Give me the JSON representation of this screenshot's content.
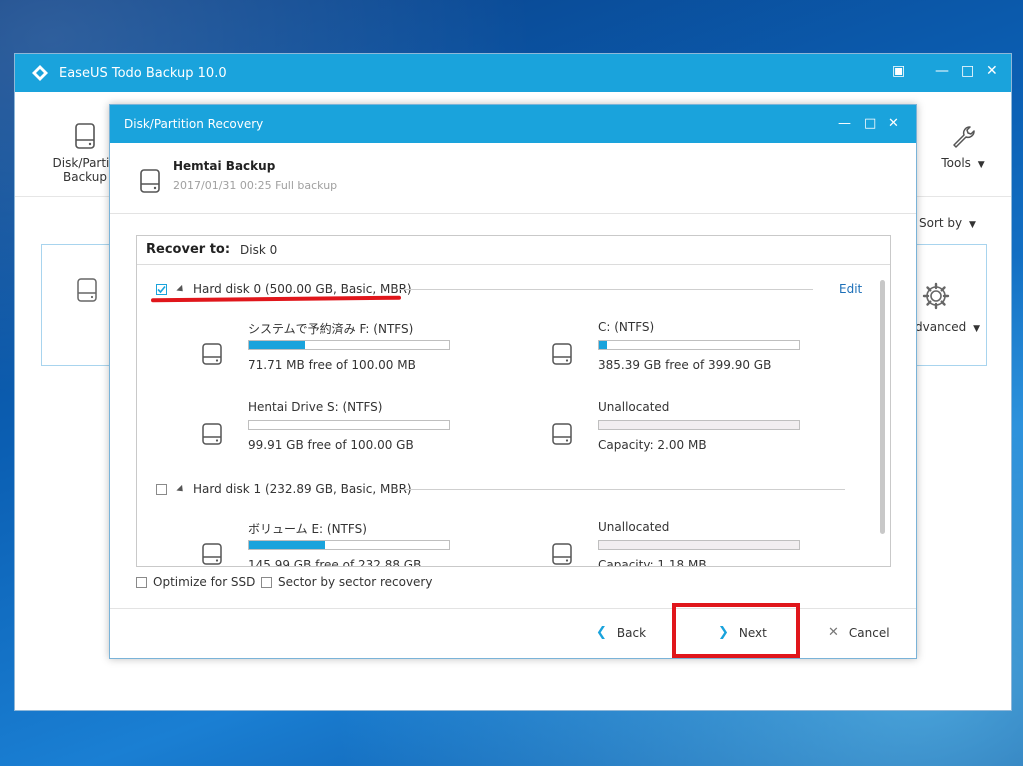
{
  "app": {
    "title": "EaseUS Todo Backup 10.0",
    "toolbar_left_label_1": "Disk/Partiti",
    "toolbar_left_label_2": "Backup",
    "tools_label": "Tools",
    "sort_label": "Sort by",
    "advanced_label": "dvanced"
  },
  "dialog": {
    "title": "Disk/Partition Recovery",
    "backup_name": "Hemtai Backup",
    "backup_meta": "2017/01/31 00:25 Full backup",
    "recover_to_label": "Recover to:",
    "recover_to_value": "Disk 0",
    "edit_label": "Edit",
    "disks": [
      {
        "label": "Hard disk 0 (500.00 GB, Basic, MBR)",
        "checked": true,
        "partitions": [
          {
            "name": "システムで予約済み  F: (NTFS)",
            "info": "71.71 MB free of 100.00 MB",
            "used_fraction": 0.28
          },
          {
            "name": "C: (NTFS)",
            "info": "385.39 GB free of 399.90 GB",
            "used_fraction": 0.04
          },
          {
            "name": "Hentai Drive S: (NTFS)",
            "info": "99.91 GB free of 100.00 GB",
            "used_fraction": 0.0
          },
          {
            "name": "Unallocated",
            "info": "Capacity: 2.00 MB",
            "used_fraction": 0.0,
            "unallocated": true
          }
        ]
      },
      {
        "label": "Hard disk 1 (232.89 GB, Basic, MBR)",
        "checked": false,
        "partitions": [
          {
            "name": "ボリューム  E: (NTFS)",
            "info": "145.99 GB free of 232.88 GB",
            "used_fraction": 0.38
          },
          {
            "name": "Unallocated",
            "info": "Capacity: 1.18 MB",
            "used_fraction": 0.0,
            "unallocated": true
          }
        ]
      }
    ],
    "options": {
      "optimize_ssd": "Optimize for SSD",
      "sector_recovery": "Sector by sector recovery"
    },
    "buttons": {
      "back": "Back",
      "next": "Next",
      "cancel": "Cancel"
    }
  },
  "colors": {
    "accent": "#1aa3dc",
    "highlight_red": "#e0161b",
    "link": "#1c6fb8"
  }
}
